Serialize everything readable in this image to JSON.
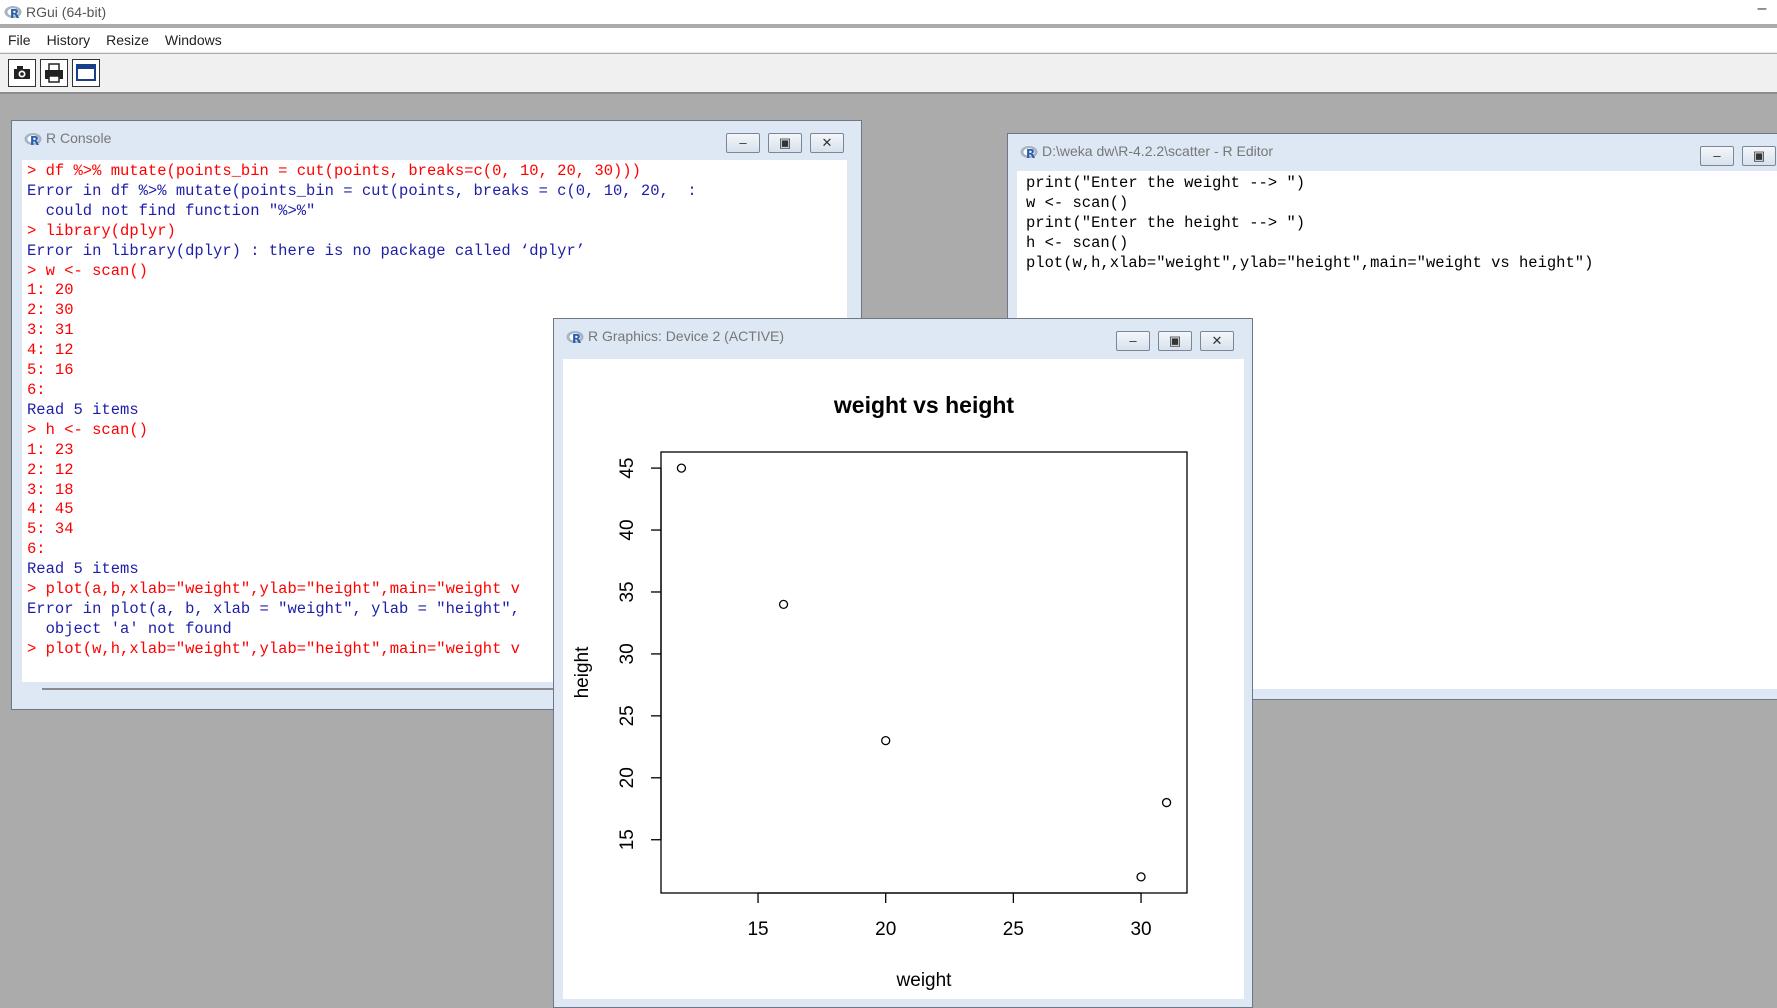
{
  "app": {
    "title": "RGui (64-bit)",
    "menu": [
      "File",
      "History",
      "Resize",
      "Windows"
    ],
    "minimize_glyph": "–",
    "toolbar_icons": [
      "camera-icon",
      "printer-icon",
      "window-icon"
    ]
  },
  "console": {
    "title": "R Console",
    "lines": [
      {
        "text": "> df %>% mutate(points_bin = cut(points, breaks=c(0, 10, 20, 30)))",
        "kind": "input"
      },
      {
        "text": "Error in df %>% mutate(points_bin = cut(points, breaks = c(0, 10, 20,  :",
        "kind": "output"
      },
      {
        "text": "  could not find function \"%>%\"",
        "kind": "output"
      },
      {
        "text": "> library(dplyr)",
        "kind": "input"
      },
      {
        "text": "Error in library(dplyr) : there is no package called ‘dplyr’",
        "kind": "output"
      },
      {
        "text": "> w <- scan()",
        "kind": "input"
      },
      {
        "text": "1: 20",
        "kind": "input"
      },
      {
        "text": "2: 30",
        "kind": "input"
      },
      {
        "text": "3: 31",
        "kind": "input"
      },
      {
        "text": "4: 12",
        "kind": "input"
      },
      {
        "text": "5: 16",
        "kind": "input"
      },
      {
        "text": "6:",
        "kind": "input"
      },
      {
        "text": "Read 5 items",
        "kind": "output"
      },
      {
        "text": "> h <- scan()",
        "kind": "input"
      },
      {
        "text": "1: 23",
        "kind": "input"
      },
      {
        "text": "2: 12",
        "kind": "input"
      },
      {
        "text": "3: 18",
        "kind": "input"
      },
      {
        "text": "4: 45",
        "kind": "input"
      },
      {
        "text": "5: 34",
        "kind": "input"
      },
      {
        "text": "6:",
        "kind": "input"
      },
      {
        "text": "Read 5 items",
        "kind": "output"
      },
      {
        "text": "> plot(a,b,xlab=\"weight\",ylab=\"height\",main=\"weight v",
        "kind": "input"
      },
      {
        "text": "Error in plot(a, b, xlab = \"weight\", ylab = \"height\",",
        "kind": "output"
      },
      {
        "text": "  object 'a' not found",
        "kind": "output"
      },
      {
        "text": "> plot(w,h,xlab=\"weight\",ylab=\"height\",main=\"weight v",
        "kind": "input"
      }
    ]
  },
  "editor": {
    "title": "D:\\weka dw\\R-4.2.2\\scatter - R Editor",
    "lines": [
      "print(\"Enter the weight --> \")",
      "w <- scan()",
      "print(\"Enter the height --> \")",
      "h <- scan()",
      "plot(w,h,xlab=\"weight\",ylab=\"height\",main=\"weight vs height\")"
    ]
  },
  "graphics": {
    "title": "R Graphics: Device 2 (ACTIVE)"
  },
  "window_buttons": {
    "minimize": "–",
    "maximize": "▣",
    "close": "✕"
  },
  "colors": {
    "input": "#ff0000",
    "output": "#1e1ea8"
  },
  "chart_data": {
    "type": "scatter",
    "title": "weight vs height",
    "xlabel": "weight",
    "ylabel": "height",
    "x": [
      20,
      30,
      31,
      12,
      16
    ],
    "y": [
      23,
      12,
      18,
      45,
      34
    ],
    "xlim": [
      11.2,
      31.8
    ],
    "ylim": [
      10.7,
      46.3
    ],
    "xticks": [
      15,
      20,
      25,
      30
    ],
    "yticks": [
      15,
      20,
      25,
      30,
      35,
      40,
      45
    ],
    "marker": "open-circle",
    "grid": false
  }
}
